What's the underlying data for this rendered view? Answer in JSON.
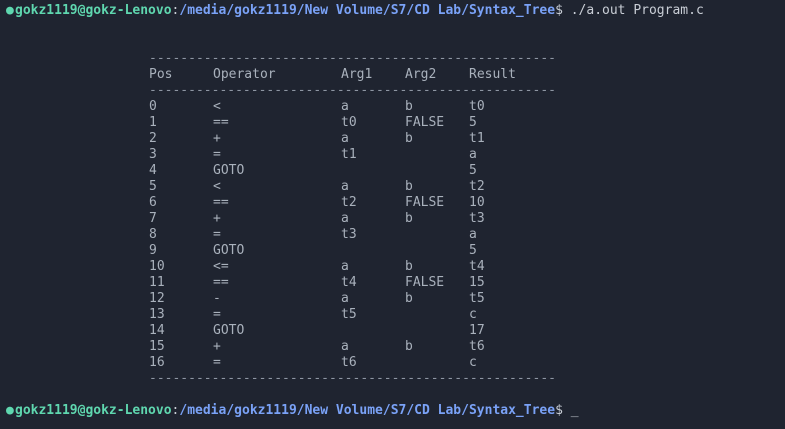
{
  "prompt": {
    "dot": "●",
    "user_host": "gokz1119@gokz-Lenovo",
    "colon": ":",
    "path": "/media/gokz1119/New Volume/S7/CD Lab/Syntax_Tree",
    "dollar": "$",
    "command": " ./a.out Program.c",
    "cursor": " _"
  },
  "table": {
    "rule": "----------------------------------------------------",
    "headers": {
      "pos": "Pos",
      "op": "Operator",
      "arg1": "Arg1",
      "arg2": "Arg2",
      "result": "Result"
    },
    "rows": [
      {
        "pos": "0",
        "op": "<",
        "arg1": "a",
        "arg2": "b",
        "result": "t0"
      },
      {
        "pos": "1",
        "op": "==",
        "arg1": "t0",
        "arg2": "FALSE",
        "result": "5"
      },
      {
        "pos": "2",
        "op": "+",
        "arg1": "a",
        "arg2": "b",
        "result": "t1"
      },
      {
        "pos": "3",
        "op": "=",
        "arg1": "t1",
        "arg2": "",
        "result": "a"
      },
      {
        "pos": "4",
        "op": "GOTO",
        "arg1": "",
        "arg2": "",
        "result": "5"
      },
      {
        "pos": "5",
        "op": "<",
        "arg1": "a",
        "arg2": "b",
        "result": "t2"
      },
      {
        "pos": "6",
        "op": "==",
        "arg1": "t2",
        "arg2": "FALSE",
        "result": "10"
      },
      {
        "pos": "7",
        "op": "+",
        "arg1": "a",
        "arg2": "b",
        "result": "t3"
      },
      {
        "pos": "8",
        "op": "=",
        "arg1": "t3",
        "arg2": "",
        "result": "a"
      },
      {
        "pos": "9",
        "op": "GOTO",
        "arg1": "",
        "arg2": "",
        "result": "5"
      },
      {
        "pos": "10",
        "op": "<=",
        "arg1": "a",
        "arg2": "b",
        "result": "t4"
      },
      {
        "pos": "11",
        "op": "==",
        "arg1": "t4",
        "arg2": "FALSE",
        "result": "15"
      },
      {
        "pos": "12",
        "op": "-",
        "arg1": "a",
        "arg2": "b",
        "result": "t5"
      },
      {
        "pos": "13",
        "op": "=",
        "arg1": "t5",
        "arg2": "",
        "result": "c"
      },
      {
        "pos": "14",
        "op": "GOTO",
        "arg1": "",
        "arg2": "",
        "result": "17"
      },
      {
        "pos": "15",
        "op": "+",
        "arg1": "a",
        "arg2": "b",
        "result": "t6"
      },
      {
        "pos": "16",
        "op": "=",
        "arg1": "t6",
        "arg2": "",
        "result": "c"
      }
    ]
  },
  "colors": {
    "background": "#1f2430",
    "user_host": "#5fd7af",
    "path": "#7aa2f7",
    "text": "#c9ced6"
  }
}
